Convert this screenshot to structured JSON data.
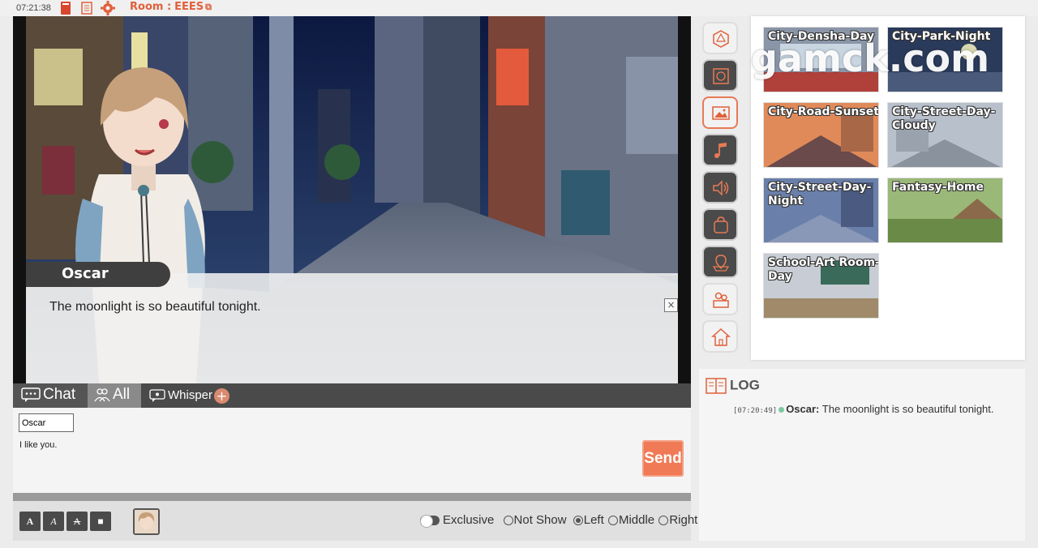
{
  "topbar": {
    "time": "07:21:38",
    "room_label": "Room :",
    "room_id": "EEES"
  },
  "scene": {
    "speaker": "Oscar",
    "dialogue": "The moonlight is so beautiful tonight.",
    "close": "×"
  },
  "chat_tabs": {
    "chat": "Chat",
    "all": "All",
    "whisper": "Whisper",
    "add": "+"
  },
  "composer": {
    "name_value": "Oscar",
    "message": "I like you.",
    "send_label": "Send"
  },
  "format_buttons": [
    "A",
    "A",
    "A",
    "■"
  ],
  "display_options": {
    "exclusive": "Exclusive",
    "not_show": "Not Show",
    "left": "Left",
    "middle": "Middle",
    "right": "Right",
    "selected": "Left"
  },
  "sidebar_icons": [
    "dice-icon",
    "map-icon",
    "image-icon",
    "music-icon",
    "speaker-icon",
    "bag-icon",
    "location-icon",
    "characters-icon",
    "home-icon"
  ],
  "backgrounds": [
    {
      "label": "City-Densha-Day"
    },
    {
      "label": "City-Park-Night"
    },
    {
      "label": "City-Road-Sunset"
    },
    {
      "label": "City-Street-Day-Cloudy"
    },
    {
      "label": "City-Street-Day-Night"
    },
    {
      "label": "Fantasy-Home"
    },
    {
      "label": "School-Art Room-Day"
    }
  ],
  "watermark": "gamck.com",
  "log": {
    "title": "LOG",
    "entries": [
      {
        "time": "[07:20:49]",
        "name": "Oscar:",
        "text": " The moonlight is so beautiful tonight."
      }
    ]
  },
  "colors": {
    "accent": "#f07a55",
    "dark": "#4a4a4a",
    "log_dot": "#7dc9a0"
  }
}
